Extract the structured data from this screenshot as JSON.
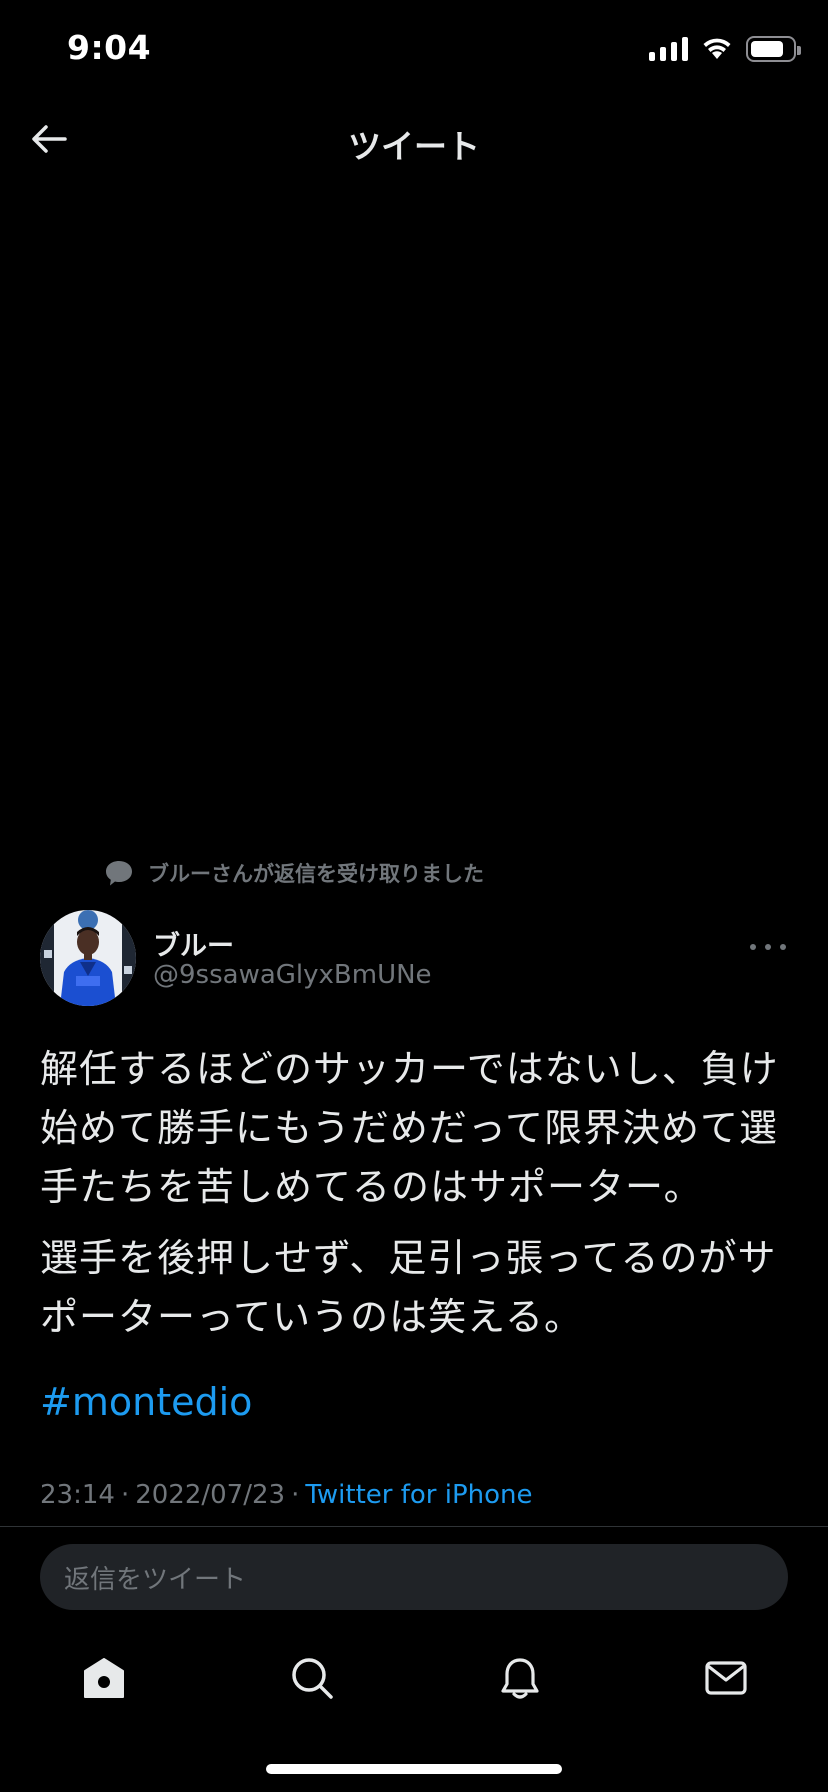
{
  "status_bar": {
    "time": "9:04",
    "battery_level": 0.8
  },
  "nav": {
    "title": "ツイート"
  },
  "tweet": {
    "social_context": "ブルーさんが返信を受け取りました",
    "author_name": "ブルー",
    "author_handle": "@9ssawaGlyxBmUNe",
    "paragraphs": [
      "解任するほどのサッカーではないし、負け始めて勝手にもうだめだって限界決めて選手たちを苦しめてるのはサポーター。",
      "選手を後押しせず、足引っ張ってるのがサポーターっていうのは笑える。"
    ],
    "hashtag": "#montedio",
    "time": "23:14",
    "date": "2022/07/23",
    "separator": "·",
    "client": "Twitter for iPhone"
  },
  "reply": {
    "placeholder": "返信をツイート"
  },
  "tabs": [
    {
      "icon": "home-icon"
    },
    {
      "icon": "search-icon"
    },
    {
      "icon": "notifications-icon"
    },
    {
      "icon": "messages-icon"
    }
  ],
  "colors": {
    "background": "#000000",
    "text": "#e7e9ea",
    "secondary": "#71767b",
    "accent": "#1d9bf0"
  }
}
